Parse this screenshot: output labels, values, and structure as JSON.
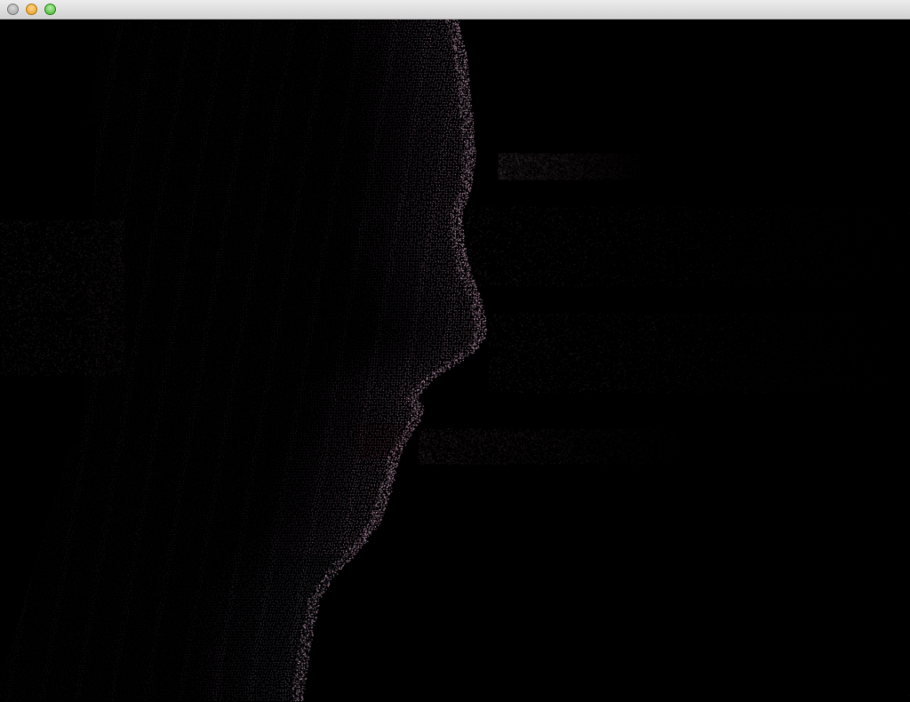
{
  "window": {
    "title": "",
    "buttons": [
      {
        "name": "close-button",
        "color": "#c8c8c8"
      },
      {
        "name": "minimize-button",
        "color": "#f5b53a"
      },
      {
        "name": "zoom-button",
        "color": "#5cc43d"
      }
    ]
  },
  "viewport": {
    "background": "#000000",
    "content": "point-cloud-face-profile",
    "colors": {
      "skin_highlight": "#e8b8d8",
      "skin_mid": "#8a6a86",
      "skin_shadow": "#3a2f3e",
      "lips": "#8a3a4a",
      "clothing": "#4a5868",
      "noise": "#6a5560"
    }
  }
}
